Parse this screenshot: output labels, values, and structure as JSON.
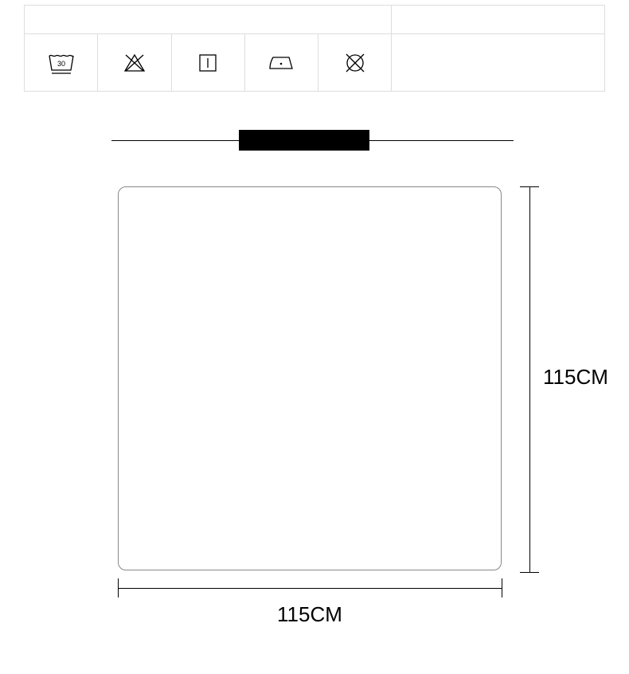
{
  "care_icons": [
    {
      "name": "wash-30-icon",
      "label": "30"
    },
    {
      "name": "do-not-bleach-icon"
    },
    {
      "name": "dry-flat-icon"
    },
    {
      "name": "iron-low-icon"
    },
    {
      "name": "do-not-dryclean-icon"
    }
  ],
  "dimensions": {
    "width_label": "115CM",
    "height_label": "115CM"
  }
}
